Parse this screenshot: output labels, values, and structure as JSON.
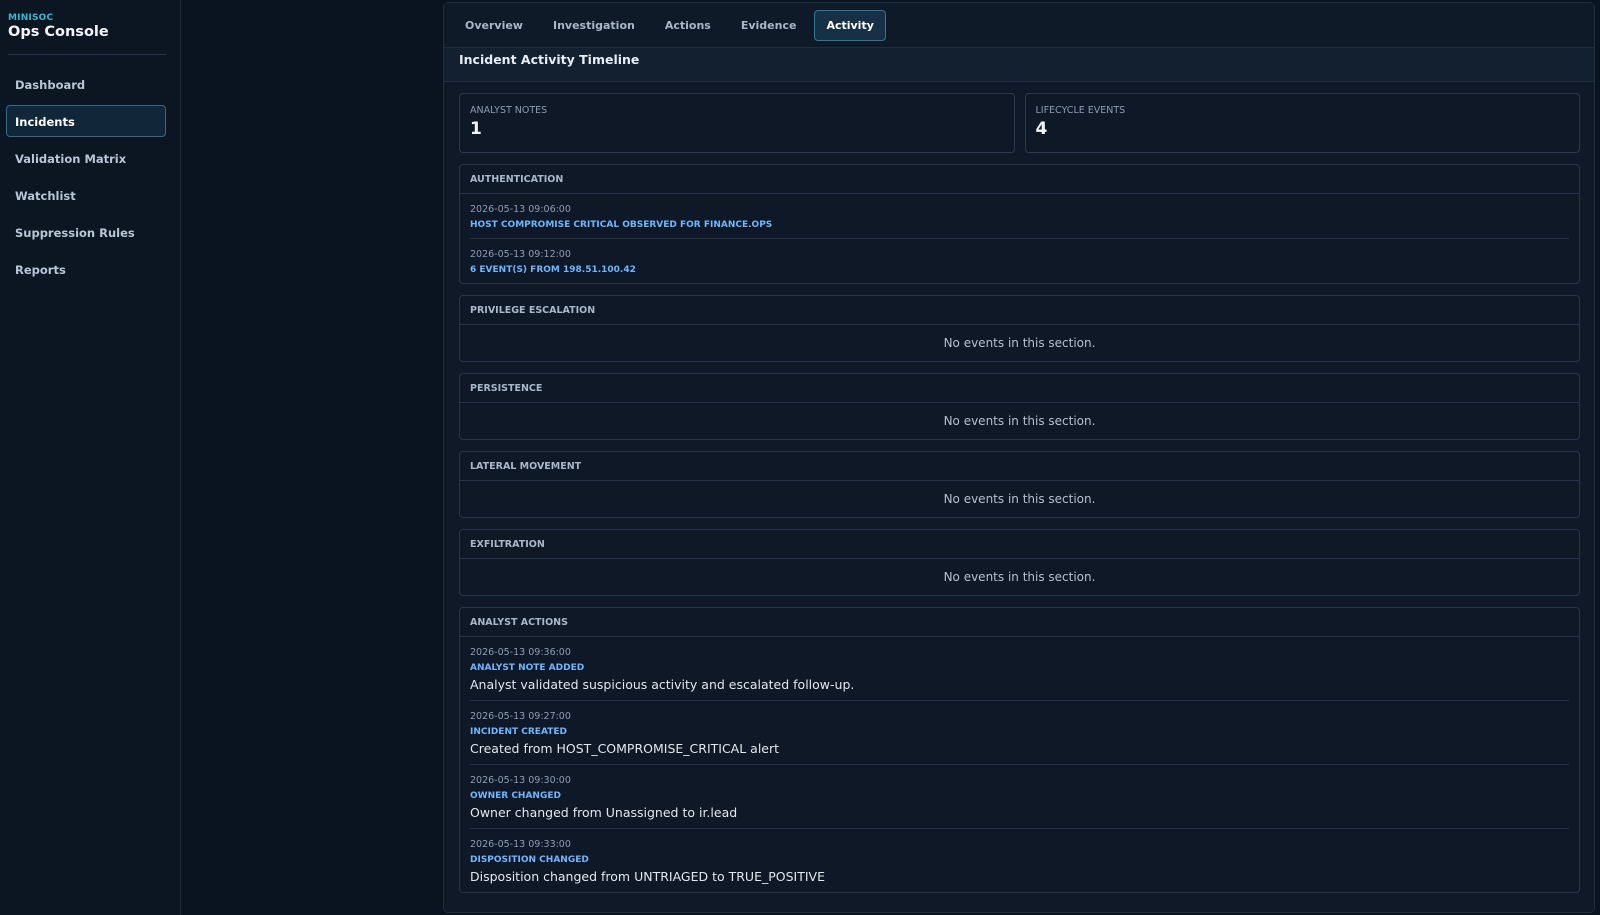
{
  "brand": {
    "kicker": "MINISOC",
    "title": "Ops Console"
  },
  "sidebar": {
    "items": [
      {
        "label": "Dashboard"
      },
      {
        "label": "Incidents"
      },
      {
        "label": "Validation Matrix"
      },
      {
        "label": "Watchlist"
      },
      {
        "label": "Suppression Rules"
      },
      {
        "label": "Reports"
      }
    ],
    "active": "Incidents"
  },
  "tabs": {
    "items": [
      {
        "label": "Overview"
      },
      {
        "label": "Investigation"
      },
      {
        "label": "Actions"
      },
      {
        "label": "Evidence"
      },
      {
        "label": "Activity"
      }
    ],
    "active": "Activity"
  },
  "timeline": {
    "title": "Incident Activity Timeline",
    "stats": {
      "notes": {
        "label": "ANALYST NOTES",
        "value": "1"
      },
      "lifecycle": {
        "label": "LIFECYCLE EVENTS",
        "value": "4"
      }
    },
    "empty_text": "No events in this section.",
    "sections": {
      "authentication": {
        "label": "AUTHENTICATION",
        "events": [
          {
            "time": "2026-05-13 09:06:00",
            "title": "HOST COMPROMISE CRITICAL OBSERVED FOR FINANCE.OPS"
          },
          {
            "time": "2026-05-13 09:12:00",
            "title": "6 EVENT(S) FROM 198.51.100.42"
          }
        ]
      },
      "privilege": {
        "label": "PRIVILEGE ESCALATION"
      },
      "persistence": {
        "label": "PERSISTENCE"
      },
      "lateral": {
        "label": "LATERAL MOVEMENT"
      },
      "exfiltration": {
        "label": "EXFILTRATION"
      },
      "analyst": {
        "label": "ANALYST ACTIONS",
        "events": [
          {
            "time": "2026-05-13 09:36:00",
            "title": "ANALYST NOTE ADDED",
            "desc": "Analyst validated suspicious activity and escalated follow-up."
          },
          {
            "time": "2026-05-13 09:27:00",
            "title": "INCIDENT CREATED",
            "desc": "Created from HOST_COMPROMISE_CRITICAL alert"
          },
          {
            "time": "2026-05-13 09:30:00",
            "title": "OWNER CHANGED",
            "desc": "Owner changed from Unassigned to ir.lead"
          },
          {
            "time": "2026-05-13 09:33:00",
            "title": "DISPOSITION CHANGED",
            "desc": "Disposition changed from UNTRIAGED to TRUE_POSITIVE"
          }
        ]
      }
    }
  },
  "colors": {
    "accent": "#35b7d3",
    "active_border": "#2d7896",
    "event_title": "#6fb6ff",
    "background": "#0a1320"
  }
}
